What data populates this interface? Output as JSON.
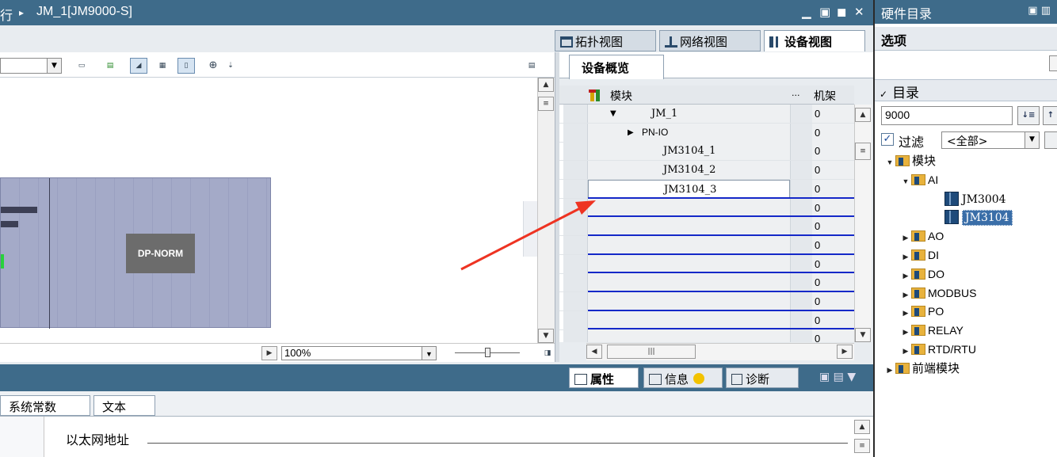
{
  "window": {
    "breadcrumb_prefix": "行",
    "breadcrumb_sep": "▸",
    "breadcrumb_device": "JM_1[JM9000-S]",
    "controls": [
      "▁",
      "▣",
      "◼",
      "✕"
    ]
  },
  "view_tabs": [
    {
      "label": "拓扑视图"
    },
    {
      "label": "网络视图"
    },
    {
      "label": "设备视图",
      "active": true
    }
  ],
  "device_view": {
    "module_label": "DP-NORM",
    "zoom": "100%"
  },
  "overview": {
    "tab_label": "设备概览",
    "columns": {
      "module": "模块",
      "dots": "...",
      "rack": "机架"
    },
    "rows": [
      {
        "name": "JM_1",
        "expander": "▼",
        "rack": "0"
      },
      {
        "name": "PN-IO",
        "expander": "▶",
        "rack": "0"
      },
      {
        "name": "JM3104_1",
        "rack": "0"
      },
      {
        "name": "JM3104_2",
        "rack": "0"
      },
      {
        "name": "JM3104_3",
        "rack": "0",
        "selected": true
      },
      {
        "name": "",
        "rack": "0"
      },
      {
        "name": "",
        "rack": "0"
      },
      {
        "name": "",
        "rack": "0"
      },
      {
        "name": "",
        "rack": "0"
      },
      {
        "name": "",
        "rack": "0"
      },
      {
        "name": "",
        "rack": "0"
      },
      {
        "name": "",
        "rack": "0"
      },
      {
        "name": "",
        "rack": "0"
      }
    ]
  },
  "inspector": {
    "tabs": [
      {
        "label": "属性",
        "active": true
      },
      {
        "label": "信息"
      },
      {
        "label": "诊断"
      }
    ],
    "property_tabs": [
      "系统常数",
      "文本"
    ],
    "ethernet_label": "以太网地址"
  },
  "hardware_catalog": {
    "title": "硬件目录",
    "options_label": "选项",
    "catalog_label": "目录",
    "search_value": "9000",
    "filter_label": "过滤",
    "filter_value": "<全部>",
    "tree": [
      {
        "label": "模块",
        "level": 0,
        "expanded": true,
        "type": "folder"
      },
      {
        "label": "AI",
        "level": 1,
        "expanded": true,
        "type": "folder"
      },
      {
        "label": "JM3004",
        "level": 2,
        "type": "module"
      },
      {
        "label": "JM3104",
        "level": 2,
        "type": "module",
        "selected": true
      },
      {
        "label": "AO",
        "level": 1,
        "type": "folder"
      },
      {
        "label": "DI",
        "level": 1,
        "type": "folder"
      },
      {
        "label": "DO",
        "level": 1,
        "type": "folder"
      },
      {
        "label": "MODBUS",
        "level": 1,
        "type": "folder"
      },
      {
        "label": "PO",
        "level": 1,
        "type": "folder"
      },
      {
        "label": "RELAY",
        "level": 1,
        "type": "folder"
      },
      {
        "label": "RTD/RTU",
        "level": 1,
        "type": "folder"
      },
      {
        "label": "前端模块",
        "level": 0,
        "type": "folder"
      }
    ]
  },
  "colors": {
    "title_bar": "#3e6b8a",
    "rack_fill": "#a4aac8",
    "module_fill": "#6c6c6c",
    "annotation_arrow": "#ee3322",
    "slot_lines": "#1428c8"
  }
}
